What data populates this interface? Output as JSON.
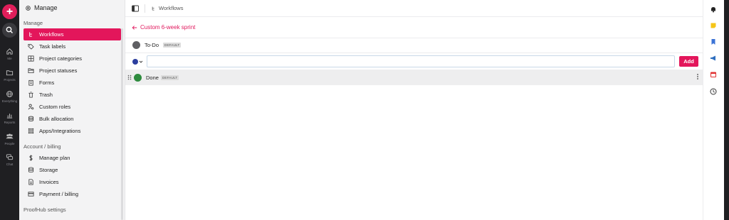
{
  "rail": {
    "items": [
      {
        "label": "Me",
        "icon": "home-icon"
      },
      {
        "label": "Projects",
        "icon": "folder-icon"
      },
      {
        "label": "Everything",
        "icon": "globe-icon"
      },
      {
        "label": "Reports",
        "icon": "chart-icon"
      },
      {
        "label": "People",
        "icon": "people-icon"
      },
      {
        "label": "Chat",
        "icon": "chat-icon"
      }
    ],
    "plus_label": "+"
  },
  "sidebar": {
    "header": "Manage",
    "sections": {
      "manage": "Manage",
      "account": "Account / billing",
      "proofhub": "ProofHub settings"
    },
    "items": [
      {
        "label": "Workflows",
        "icon": "workflow-icon"
      },
      {
        "label": "Task labels",
        "icon": "tag-icon"
      },
      {
        "label": "Project categories",
        "icon": "grid-icon"
      },
      {
        "label": "Project statuses",
        "icon": "folder-open-icon"
      },
      {
        "label": "Forms",
        "icon": "clipboard-icon"
      },
      {
        "label": "Trash",
        "icon": "trash-icon"
      },
      {
        "label": "Custom roles",
        "icon": "user-roles-icon"
      },
      {
        "label": "Bulk allocation",
        "icon": "layers-icon"
      },
      {
        "label": "Apps/Integrations",
        "icon": "apps-icon"
      }
    ],
    "account_items": [
      {
        "label": "Manage plan",
        "icon": "dollar-icon"
      },
      {
        "label": "Storage",
        "icon": "database-icon"
      },
      {
        "label": "Invoices",
        "icon": "invoice-icon"
      },
      {
        "label": "Payment / billing",
        "icon": "credit-card-icon"
      }
    ]
  },
  "topbar": {
    "breadcrumb": "Workflows"
  },
  "main": {
    "back_label": "Custom 6-week sprint",
    "statuses": [
      {
        "name": "To-Do",
        "badge": "DEFAULT",
        "color": "#5f5f63"
      },
      {
        "name": "Done",
        "badge": "DEFAULT",
        "color": "#2e8b3e"
      }
    ],
    "input": {
      "value": "",
      "placeholder": ""
    },
    "picker_color": "#2c3e9e",
    "add_label": "Add"
  },
  "colors": {
    "accent": "#e3165b",
    "rail_bg": "#1f1f22"
  },
  "right_rail": [
    "bell-icon",
    "note-icon",
    "bookmark-icon",
    "megaphone-icon",
    "calendar-icon",
    "clock-icon"
  ]
}
